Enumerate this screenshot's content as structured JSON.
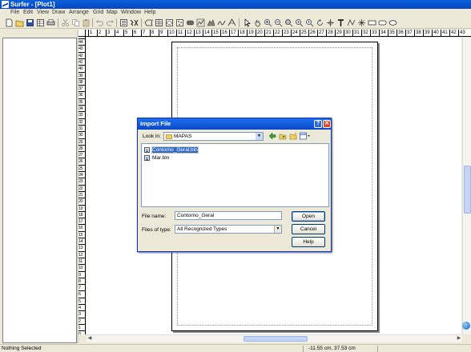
{
  "window": {
    "title": "Surfer - [Plot1]"
  },
  "menu": [
    "File",
    "Edit",
    "View",
    "Draw",
    "Arrange",
    "Grid",
    "Map",
    "Window",
    "Help"
  ],
  "toolbar": {
    "icons": [
      "new-icon",
      "open-icon",
      "save-icon",
      "worksheet-icon",
      "print-icon",
      "cut-icon",
      "copy-icon",
      "paste-icon",
      "undo-icon",
      "redo-icon",
      "object-manager-icon",
      "properties-icon",
      "polygon-icon",
      "grid-data-icon",
      "contour-map-icon",
      "post-map-icon",
      "image-map-icon",
      "vector-map-icon",
      "shaded-relief-icon",
      "3d-surface-icon",
      "wireframe-icon",
      "select-icon",
      "pan-icon",
      "zoom-in-icon",
      "zoom-out-icon",
      "zoom-rect-icon",
      "zoom-page-icon",
      "zoom-actual-icon",
      "rotate-icon",
      "digitize-icon",
      "text-icon",
      "polyline-icon",
      "symbol-icon",
      "rectangle-icon",
      "rounded-rect-icon",
      "ellipse-icon"
    ]
  },
  "rulers": {
    "top": [
      "1",
      "2",
      "3",
      "4",
      "5",
      "6",
      "7",
      "8",
      "9",
      "10",
      "11",
      "12",
      "13",
      "14",
      "15",
      "16",
      "17",
      "18",
      "19",
      "20",
      "21",
      "22",
      "23",
      "24",
      "25",
      "26",
      "27",
      "28",
      "29",
      "30",
      "31",
      "32",
      "33",
      "34",
      "35",
      "36",
      "37",
      "38",
      "39",
      "40",
      "41",
      "42",
      "43"
    ],
    "left": [
      "44",
      "43",
      "42",
      "41",
      "40",
      "39",
      "38",
      "37",
      "36",
      "35",
      "34",
      "33",
      "32",
      "31",
      "30",
      "29",
      "28",
      "27",
      "26",
      "25",
      "24",
      "23",
      "22",
      "21",
      "20",
      "19",
      "18",
      "17",
      "16",
      "15",
      "14",
      "13",
      "12",
      "11",
      "10",
      "9",
      "8",
      "7",
      "6",
      "5",
      "4",
      "3",
      "2",
      "1",
      "0"
    ]
  },
  "dialog": {
    "title": "Import File",
    "look_in_label": "Look in:",
    "look_in_value": "MAPAS",
    "files": [
      {
        "name": "Contorno_Geral.bln",
        "selected": true
      },
      {
        "name": "Mar.bln",
        "selected": false
      }
    ],
    "file_name_label": "File name:",
    "file_name_value": "Contorno_Geral",
    "file_type_label": "Files of type:",
    "file_type_value": "All Recognized Types",
    "open_label": "Open",
    "cancel_label": "Cancel",
    "help_label": "Help",
    "help_glyph": "?",
    "close_glyph": "✕"
  },
  "statusbar": {
    "message": "Nothing Selected",
    "coordinates": "-11.55 cm, 37.53 cm"
  }
}
